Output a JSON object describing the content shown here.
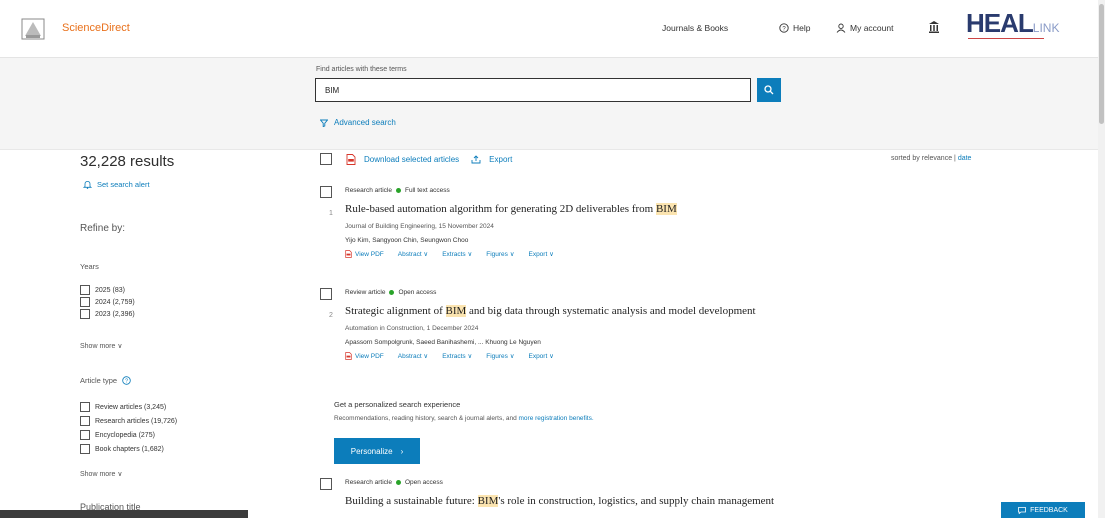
{
  "header": {
    "brand": "ScienceDirect",
    "nav_journals": "Journals & Books",
    "nav_help": "Help",
    "nav_account": "My account",
    "partner_logo": "HEAL",
    "partner_logo_suffix": "LINK"
  },
  "search": {
    "label": "Find articles with these terms",
    "value": "BIM",
    "advanced": "Advanced search"
  },
  "sidebar": {
    "results_count": "32,228 results",
    "alert": "Set search alert",
    "refine": "Refine by:",
    "years_heading": "Years",
    "years": [
      "2025 (83)",
      "2024 (2,759)",
      "2023 (2,396)"
    ],
    "show_more_1": "Show more ∨",
    "article_type_heading": "Article type",
    "article_types": [
      "Review articles (3,245)",
      "Research articles (19,726)",
      "Encyclopedia (275)",
      "Book chapters (1,682)"
    ],
    "show_more_2": "Show more ∨",
    "publication_title": "Publication title"
  },
  "toolbar": {
    "download": "Download selected articles",
    "export": "Export",
    "sorted_by": "sorted by relevance | ",
    "sort_date": "date"
  },
  "results": [
    {
      "type": "Research article",
      "access": "Full text access",
      "title_pre": "Rule-based automation algorithm for generating 2D deliverables from ",
      "title_hl": "BIM",
      "title_post": "",
      "journal": "Journal of Building Engineering, 15 November 2024",
      "authors": "Yijo Kim, Sangyoon Chin, Seungwon Choo",
      "index": "1"
    },
    {
      "type": "Review article",
      "access": "Open access",
      "title_pre": "Strategic alignment of ",
      "title_hl": "BIM",
      "title_post": " and big data through systematic analysis and model development",
      "journal": "Automation in Construction, 1 December 2024",
      "authors": "Apassorn Sompolgrunk, Saeed Banihashemi, ... Khuong Le Nguyen",
      "index": "2"
    },
    {
      "type": "Research article",
      "access": "Open access",
      "title_pre": "Building a sustainable future: ",
      "title_hl": "BIM",
      "title_post": "'s role in construction, logistics, and supply chain management",
      "journal": "",
      "authors": "",
      "index": ""
    }
  ],
  "result_links": {
    "pdf": "View PDF",
    "abstract": "Abstract ∨",
    "extracts": "Extracts ∨",
    "figures": "Figures ∨",
    "export": "Export ∨"
  },
  "promo": {
    "title": "Get a personalized search experience",
    "text": "Recommendations, reading history, search & journal alerts, and ",
    "link": "more registration benefits.",
    "button": "Personalize"
  },
  "feedback": "FEEDBACK",
  "colors": {
    "accent": "#0c7dbb",
    "brand": "#e9711c",
    "highlight": "#fbe4b0",
    "open_access": "#29a329"
  }
}
